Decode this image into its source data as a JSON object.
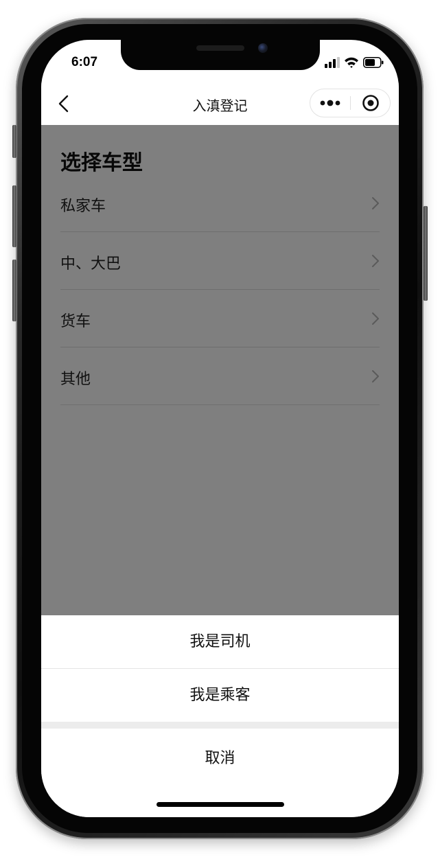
{
  "status_bar": {
    "time": "6:07",
    "icons": [
      "signal-icon",
      "wifi-icon",
      "battery-icon"
    ]
  },
  "nav": {
    "title": "入滇登记",
    "back_icon": "chevron-left-icon",
    "more_icon": "more-dots-icon",
    "close_icon": "target-icon"
  },
  "page": {
    "title": "选择车型",
    "vehicle_types": [
      {
        "label": "私家车"
      },
      {
        "label": "中、大巴"
      },
      {
        "label": "货车"
      },
      {
        "label": "其他"
      }
    ]
  },
  "action_sheet": {
    "options": [
      {
        "label": "我是司机"
      },
      {
        "label": "我是乘客"
      }
    ],
    "cancel_label": "取消"
  },
  "colors": {
    "mask": "#000000",
    "text_primary": "#111111",
    "separator": "#dcdcdc"
  }
}
